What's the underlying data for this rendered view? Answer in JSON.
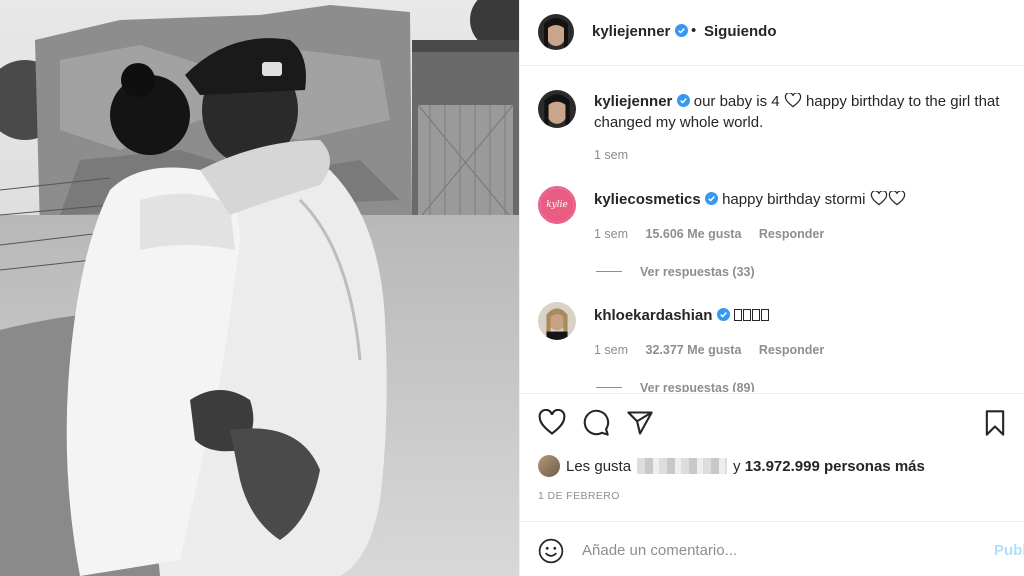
{
  "header": {
    "username": "kyliejenner",
    "separator": "•",
    "follow_label": "Siguiendo"
  },
  "caption": {
    "username": "kyliejenner",
    "text_before_heart": "our baby is 4",
    "text_after_heart": "happy birthday to the girl that changed my whole world.",
    "time": "1 sem"
  },
  "comments": [
    {
      "username": "kyliecosmetics",
      "avatar_text": "kylie",
      "text": "happy birthday stormi",
      "time": "1 sem",
      "likes": "15.606 Me gusta",
      "reply_label": "Responder",
      "view_replies": "Ver respuestas (33)"
    },
    {
      "username": "khloekardashian",
      "text": "",
      "time": "1 sem",
      "likes": "32.377 Me gusta",
      "reply_label": "Responder",
      "view_replies": "Ver respuestas (89)"
    }
  ],
  "likes": {
    "prefix": "Les gusta",
    "count_text": "13.972.999 personas más",
    "connector": "y"
  },
  "date": "1 DE FEBRERO",
  "add_comment": {
    "placeholder": "Añade un comentario...",
    "post_label": "Publicar"
  },
  "colors": {
    "verified": "#3897f0",
    "link": "#0095f6",
    "post_disabled": "#b2dffc",
    "secondary_text": "#8e8e8e"
  }
}
